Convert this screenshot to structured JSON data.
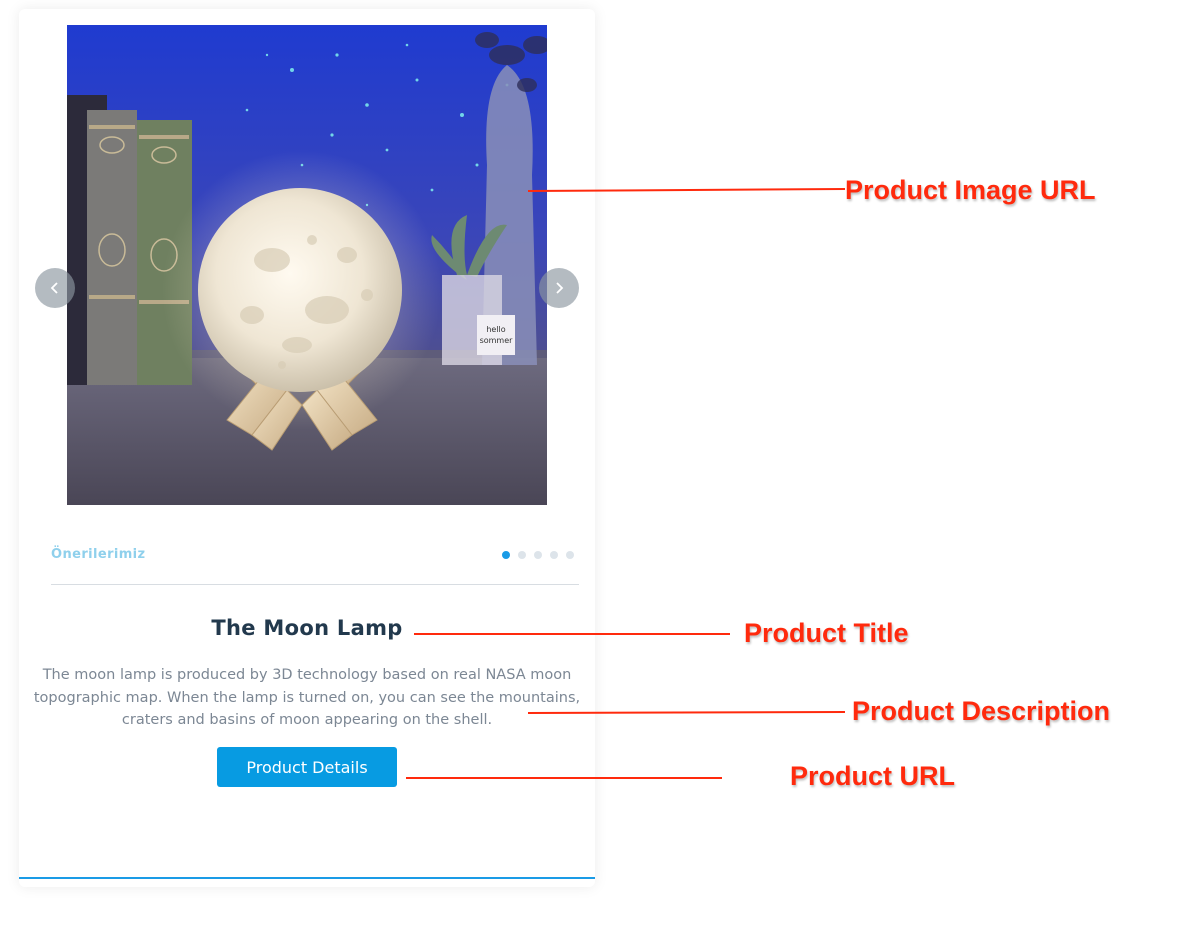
{
  "card": {
    "section_label": "Önerilerimiz",
    "carousel": {
      "slide_count": 5,
      "active_index": 0
    },
    "product": {
      "title": "The Moon Lamp",
      "description": "The moon lamp is produced by 3D technology based on real NASA moon topographic map. When the lamp is turned on, you can see the mountains, craters and basins of moon appearing on the shell.",
      "button_label": "Product Details"
    }
  },
  "annotations": {
    "image_url": "Product Image URL",
    "title": "Product Title",
    "description": "Product Description",
    "url": "Product URL"
  },
  "icons": {
    "prev": "chevron-left-icon",
    "next": "chevron-right-icon"
  },
  "colors": {
    "accent": "#1a9be6",
    "button": "#079be2",
    "title": "#22394d",
    "text": "#7c8794",
    "label": "#8fd0ec",
    "annotation": "#ff2a0d"
  }
}
